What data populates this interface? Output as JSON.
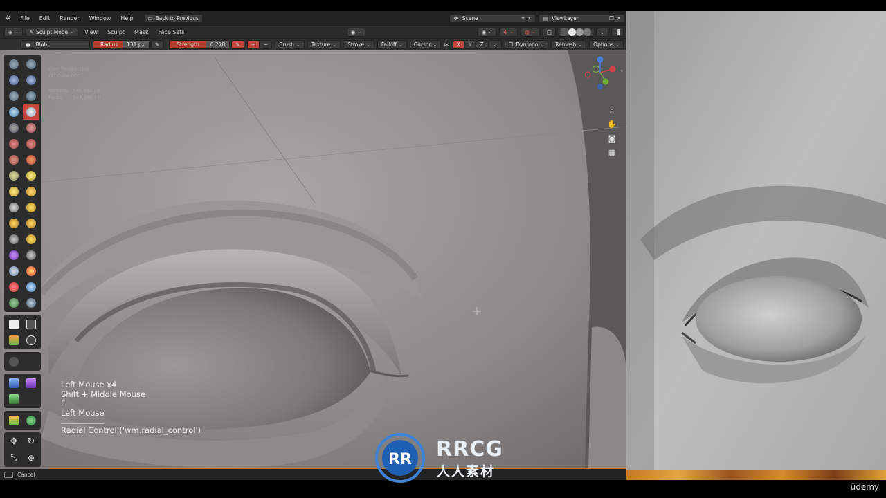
{
  "topbar": {
    "menus": [
      "File",
      "Edit",
      "Render",
      "Window",
      "Help"
    ],
    "back_button": "Back to Previous",
    "scene": "Scene",
    "view_layer": "ViewLayer"
  },
  "modebar": {
    "mode": "Sculpt Mode",
    "menus": [
      "View",
      "Sculpt",
      "Mask",
      "Face Sets"
    ]
  },
  "toolbar": {
    "brush_name": "Blob",
    "radius_label": "Radius",
    "radius_value": "131 px",
    "strength_label": "Strength",
    "strength_value": "0.278",
    "dropdowns": [
      "Brush",
      "Texture",
      "Stroke",
      "Falloff",
      "Cursor"
    ],
    "axis_x": "X",
    "axis_y": "Y",
    "axis_z": "Z",
    "dyntopo": "Dyntopo",
    "remesh": "Remesh",
    "options": "Options"
  },
  "viewport": {
    "view_name": "User Perspective",
    "object_name": "(1) Cube.001",
    "vertices_label": "Vertices",
    "vertices_value": "548,962 / 0",
    "faces_label": "Faces",
    "faces_value": "548,960 / 0"
  },
  "keylog": {
    "line1": "Left Mouse x4",
    "line2": "Shift + Middle Mouse",
    "line3": "F",
    "line4": "Left Mouse",
    "operator": "Radial Control ('wm.radial_control')"
  },
  "statusbar": {
    "cancel": "Cancel"
  },
  "watermark": {
    "latin": "RRCG",
    "cjk": "人人素材",
    "logo": "RR"
  },
  "brand": {
    "udemy": "ūdemy"
  },
  "colors": {
    "active_tool": "#c8453b",
    "radius_field": "#b3382c",
    "clay": "#8f8b8b"
  }
}
